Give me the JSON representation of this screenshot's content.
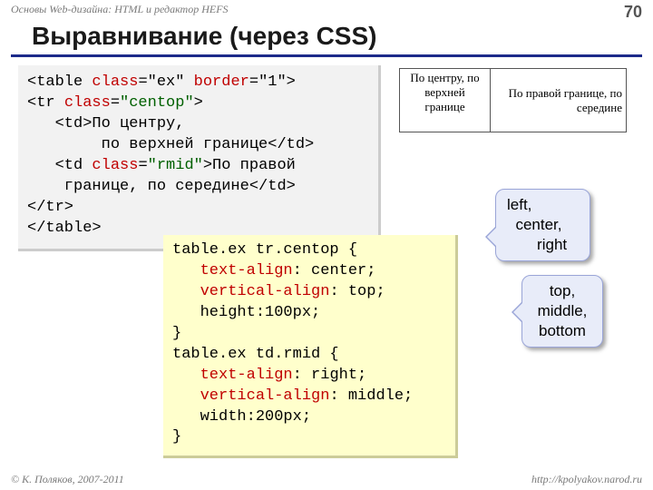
{
  "header": {
    "course": "Основы Web-дизайна: HTML и редактор HEFS",
    "page_num": "70"
  },
  "title": "Выравнивание (через CSS)",
  "html_code": {
    "l1a": "<table ",
    "l1b": "class",
    "l1c": "=\"ex\" ",
    "l1d": "border",
    "l1e": "=\"1\">",
    "l2a": "<tr ",
    "l2b": "class",
    "l2c": "=",
    "l2d": "\"centop\"",
    "l2e": ">",
    "l3": "   <td>По центру,",
    "l4": "        по верхней границе</td>",
    "l5a": "   <td ",
    "l5b": "class",
    "l5c": "=",
    "l5d": "\"rmid\"",
    "l5e": ">По правой",
    "l6": "    границе, по середине</td>",
    "l7": "</tr>",
    "l8": "</table>"
  },
  "example": {
    "cell1": "По центру, по верхней границе",
    "cell2": "По правой границе, по середине"
  },
  "css_code": {
    "l1": "table.ex tr.centop {",
    "l2a": "   ",
    "l2b": "text-align",
    "l2c": ": center;",
    "l3a": "   ",
    "l3b": "vertical-align",
    "l3c": ": top;",
    "l4": "   height:100px;",
    "l5": "}",
    "l6": "table.ex td.rmid {",
    "l7a": "   ",
    "l7b": "text-align",
    "l7c": ": right;",
    "l8a": "   ",
    "l8b": "vertical-align",
    "l8c": ": middle;",
    "l9": "   width:200px;",
    "l10": "}"
  },
  "callouts": {
    "text_align_l1": "left,",
    "text_align_l2": "  center,",
    "text_align_l3": "       right",
    "vertical_align_l1": "top,",
    "vertical_align_l2": "middle,",
    "vertical_align_l3": "bottom"
  },
  "footer": {
    "copyright": "© К. Поляков, 2007-2011",
    "url": "http://kpolyakov.narod.ru"
  }
}
